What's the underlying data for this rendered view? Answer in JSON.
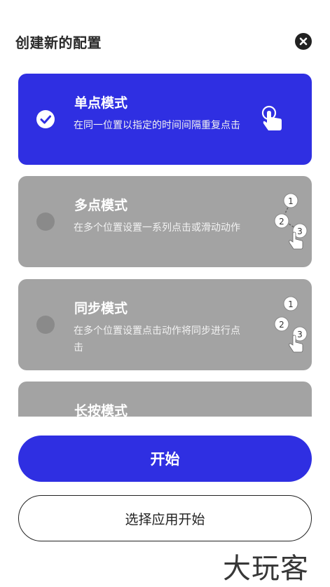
{
  "dialog": {
    "title": "创建新的配置",
    "close_icon": "close-icon"
  },
  "modes": [
    {
      "title": "单点模式",
      "desc": "在同一位置以指定的时间间隔重复点击",
      "selected": true,
      "icon": "single-tap-icon"
    },
    {
      "title": "多点模式",
      "desc": "在多个位置设置一系列点击或滑动动作",
      "selected": false,
      "icon": "multi-tap-icon",
      "steps": [
        "1",
        "2",
        "3"
      ]
    },
    {
      "title": "同步模式",
      "desc": "在多个位置设置点击动作将同步进行点击",
      "selected": false,
      "icon": "sync-tap-icon",
      "steps": [
        "1",
        "2",
        "3"
      ]
    },
    {
      "title": "长按模式",
      "desc": "",
      "selected": false,
      "icon": "long-press-icon"
    }
  ],
  "buttons": {
    "start": "开始",
    "choose_app_start": "选择应用开始"
  },
  "watermark": "大玩客",
  "colors": {
    "accent": "#2f2fe2",
    "card_inactive": "#a3a3a3",
    "radio_inactive": "#8a8a8a"
  }
}
